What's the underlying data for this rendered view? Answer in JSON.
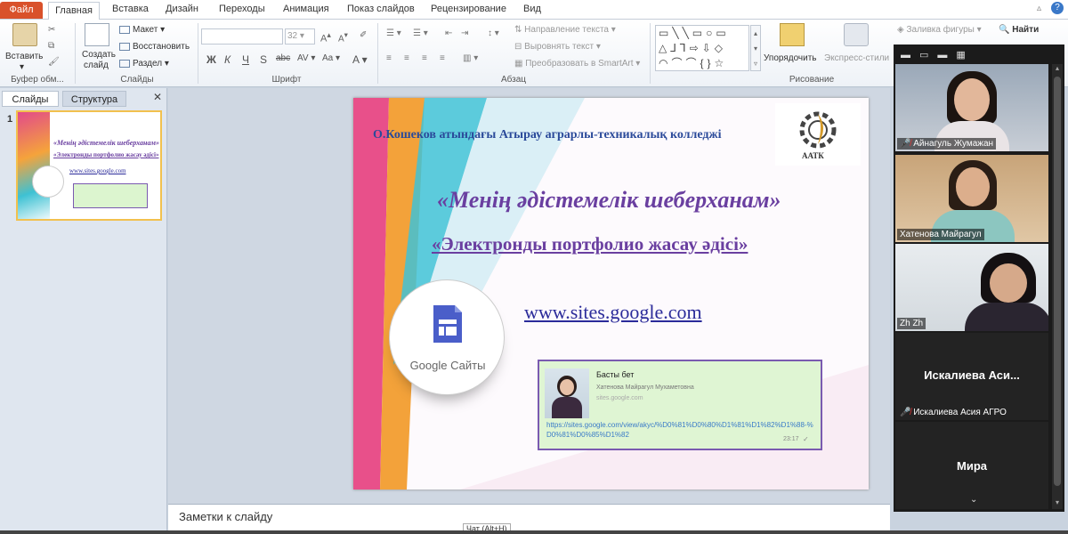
{
  "tabs": {
    "file": "Файл",
    "items": [
      "Главная",
      "Вставка",
      "Дизайн",
      "Переходы",
      "Анимация",
      "Показ слайдов",
      "Рецензирование",
      "Вид"
    ]
  },
  "ribbon": {
    "clipboard": {
      "paste": "Вставить",
      "label": "Буфер обм..."
    },
    "slides": {
      "create": "Создать",
      "create2": "слайд",
      "layout": "Макет",
      "reset": "Восстановить",
      "section": "Раздел",
      "label": "Слайды"
    },
    "font": {
      "size": "32",
      "label": "Шрифт"
    },
    "paragraph": {
      "text_direction": "Направление текста",
      "align_text": "Выровнять текст",
      "smartart": "Преобразовать в SmartArt",
      "label": "Абзац"
    },
    "drawing": {
      "arrange": "Упорядочить",
      "quick_styles": "Экспресс-стили",
      "fill": "Заливка фигуры",
      "label": "Рисование"
    },
    "editing": {
      "find": "Найти"
    }
  },
  "left_pane": {
    "tab_slides": "Слайды",
    "tab_outline": "Структура",
    "slide_number": "1"
  },
  "slide": {
    "college": "О.Кошеков атындағы Атырау аграрлы-техникалық колледжі",
    "logo_text": "ААТК",
    "title": "«Менің әдістемелік шеберханам»",
    "subtitle": "«Электронды портфолио жасау әдісі»",
    "url": "www.sites.google.com",
    "google_sites": "Google Сайты",
    "card_title": "Басты бет",
    "card_name": "Хатенова Майрагул Мухаметовна",
    "card_domain": "sites.google.com",
    "card_link": "https://sites.google.com/view/akyc/%D0%81%D0%80%D1%81%D1%82%D1%88-%D0%81%D0%85%D1%82",
    "card_time": "23:17"
  },
  "notes": {
    "placeholder": "Заметки к слайду"
  },
  "status": {
    "chat_tooltip": "Чат (Alt+H)"
  },
  "video": {
    "participants": [
      {
        "name": "Айнагуль Жумажан"
      },
      {
        "name": "Хатенова Майрагул"
      },
      {
        "name": "Zh Zh"
      },
      {
        "name": "Искалиева Асия АГРО",
        "display": "Искалиева Аси..."
      },
      {
        "name": "Мира",
        "display": "Мира"
      }
    ]
  },
  "colors": {
    "file_tab": "#d9512b",
    "accent_yellow": "#f2c14e",
    "title_purple": "#6a3fa0",
    "college_blue": "#2b4a9a"
  }
}
